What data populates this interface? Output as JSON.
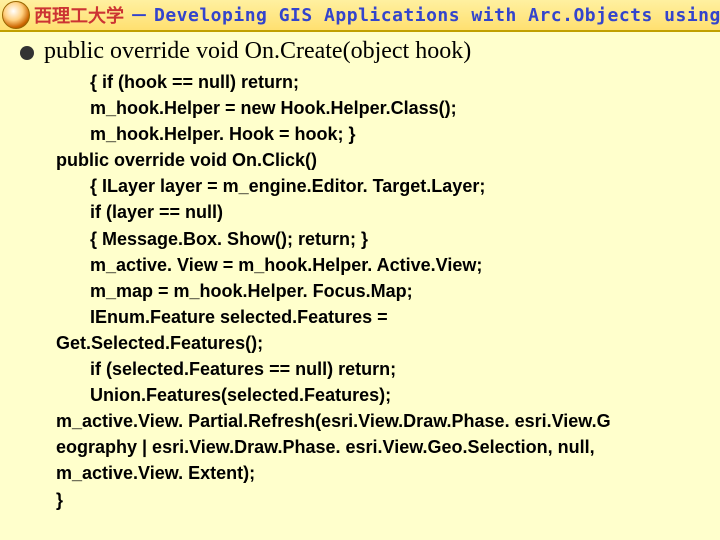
{
  "header": {
    "university": "西理工大学",
    "separator": "－",
    "subtitle": "Developing GIS Applications with Arc.Objects using C#. NE"
  },
  "bullet": {
    "text": "public override void On.Create(object hook)"
  },
  "code": {
    "l01": "{       if (hook == null) return;",
    "l02": "         m_hook.Helper = new Hook.Helper.Class();",
    "l03": "         m_hook.Helper. Hook = hook;         }",
    "l04": "public override void On.Click()",
    "l05": "{       ILayer layer = m_engine.Editor. Target.Layer;",
    "l06": "         if (layer == null)",
    "l07": "         {     Message.Box. Show();          return;      }",
    "l08": "         m_active. View = m_hook.Helper. Active.View;",
    "l09": "         m_map = m_hook.Helper. Focus.Map;",
    "l10": "         IEnum.Feature selected.Features =",
    "l11": "Get.Selected.Features();",
    "l12": "         if (selected.Features == null) return;",
    "l13": "         Union.Features(selected.Features);",
    "l14": "m_active.View. Partial.Refresh(esri.View.Draw.Phase. esri.View.G",
    "l15": "eography | esri.View.Draw.Phase. esri.View.Geo.Selection, null,",
    "l16": "m_active.View. Extent);",
    "l17": "     }"
  }
}
